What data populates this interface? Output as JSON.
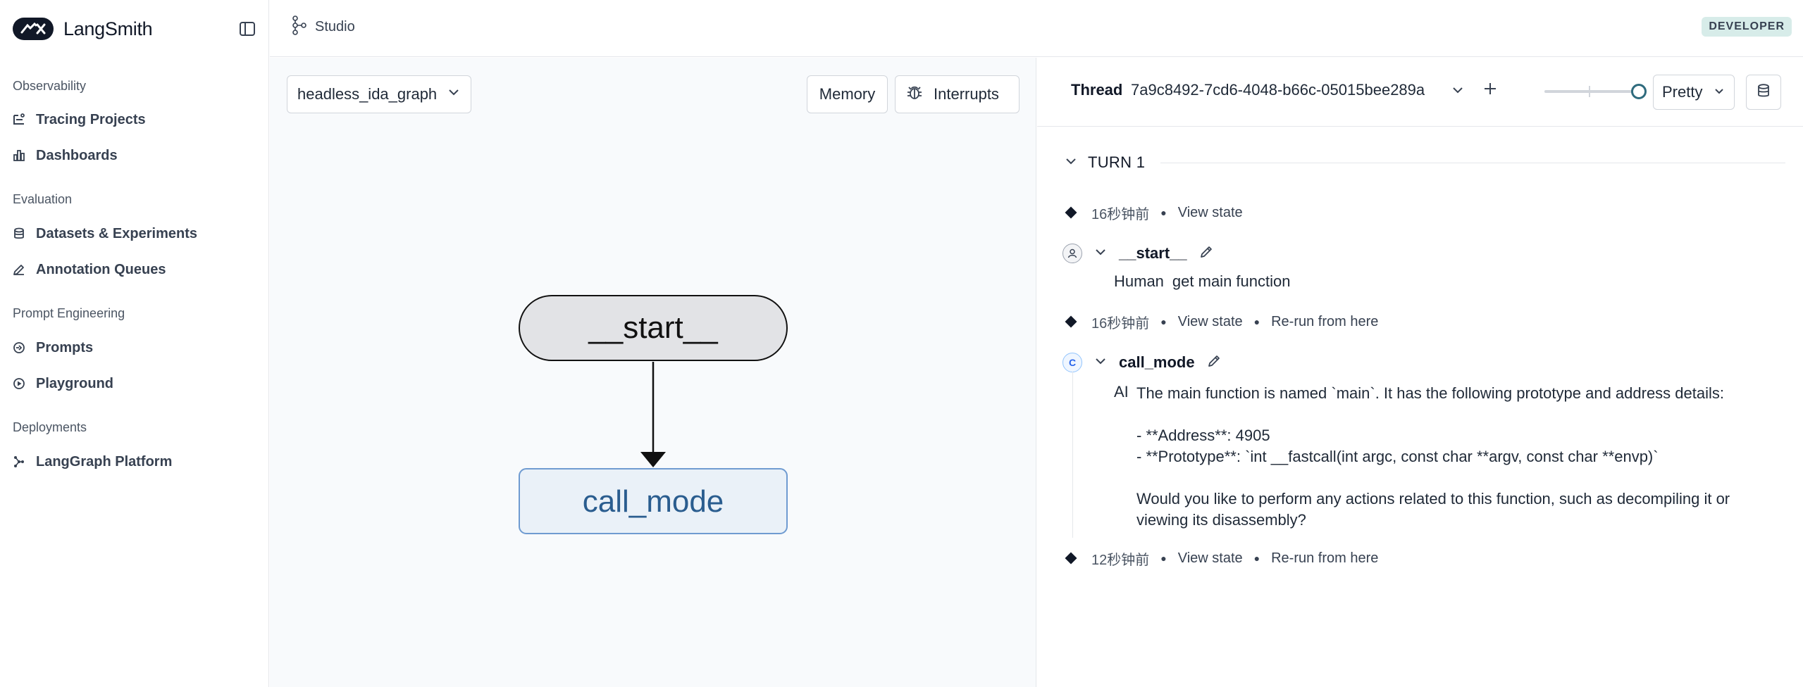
{
  "sidebar": {
    "brand": "LangSmith",
    "sections": [
      {
        "title": "Observability",
        "items": [
          {
            "label": "Tracing Projects",
            "icon": "tracing-icon"
          },
          {
            "label": "Dashboards",
            "icon": "dashboard-icon"
          }
        ]
      },
      {
        "title": "Evaluation",
        "items": [
          {
            "label": "Datasets & Experiments",
            "icon": "database-icon"
          },
          {
            "label": "Annotation Queues",
            "icon": "pen-icon"
          }
        ]
      },
      {
        "title": "Prompt Engineering",
        "items": [
          {
            "label": "Prompts",
            "icon": "prompt-icon"
          },
          {
            "label": "Playground",
            "icon": "play-icon"
          }
        ]
      },
      {
        "title": "Deployments",
        "items": [
          {
            "label": "LangGraph Platform",
            "icon": "graph-icon"
          }
        ]
      }
    ]
  },
  "topbar": {
    "studio_label": "Studio",
    "badge": "DEVELOPER"
  },
  "graph": {
    "selected_graph": "headless_ida_graph",
    "memory_label": "Memory",
    "interrupts_label": "Interrupts",
    "nodes": [
      {
        "id": "start",
        "label": "__start__"
      },
      {
        "id": "call_mode",
        "label": "call_mode"
      }
    ]
  },
  "thread": {
    "label": "Thread",
    "id": "7a9c8492-7cd6-4048-b66c-05015bee289a",
    "view_mode": "Pretty",
    "turn": "TURN 1",
    "meta": [
      {
        "time": "16秒钟前",
        "view": "View state",
        "rerun": ""
      },
      {
        "time": "16秒钟前",
        "view": "View state",
        "rerun": "Re-run from here"
      },
      {
        "time": "12秒钟前",
        "view": "View state",
        "rerun": "Re-run from here"
      }
    ],
    "start_node": {
      "name": "__start__",
      "role": "Human",
      "message": "get main function"
    },
    "call_node": {
      "name": "call_mode",
      "avatar": "C",
      "role": "AI",
      "message": "The main function is named `main`. It has the following prototype and address details:\n\n- **Address**: 4905\n- **Prototype**: `int __fastcall(int argc, const char **argv, const char **envp)`\n\nWould you like to perform any actions related to this function, such as decompiling it or viewing its disassembly?"
    }
  },
  "colors": {
    "accent": "#2f6b7d",
    "badge_bg": "#d7ece9",
    "call_node_fill": "#eaf1f8",
    "call_node_stroke": "#6f9bd1",
    "call_node_text": "#2a5d8f",
    "start_node_fill": "#e2e3e6"
  }
}
